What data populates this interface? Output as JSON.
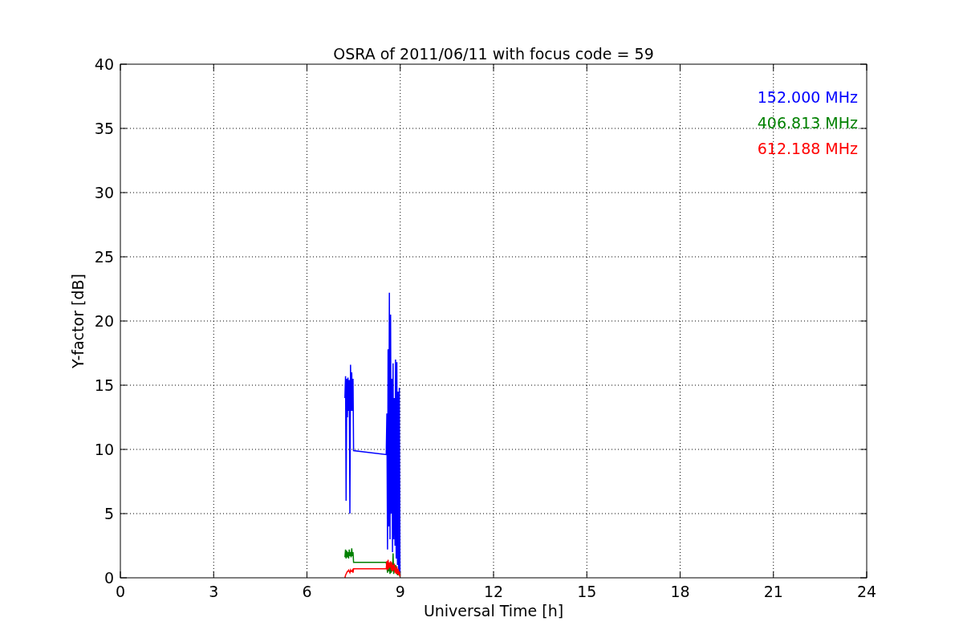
{
  "chart_data": {
    "type": "line",
    "title": "OSRA of 2011/06/11 with focus code = 59",
    "xlabel": "Universal Time [h]",
    "ylabel": "Y-factor [dB]",
    "x": [
      7.22,
      7.24,
      7.26,
      7.28,
      7.3,
      7.32,
      7.34,
      7.36,
      7.38,
      7.4,
      7.42,
      7.44,
      7.46,
      7.48,
      7.5,
      8.55,
      8.57,
      8.59,
      8.61,
      8.63,
      8.65,
      8.67,
      8.69,
      8.71,
      8.73,
      8.75,
      8.77,
      8.79,
      8.81,
      8.83,
      8.85,
      8.87,
      8.89,
      8.91,
      8.93,
      8.95,
      8.97,
      8.99
    ],
    "series": [
      {
        "name": "152.000 MHz",
        "color": "#0000ff",
        "values": [
          14,
          15.7,
          6,
          15.5,
          12.5,
          15.6,
          13,
          15.4,
          5,
          16.6,
          13,
          16,
          13,
          15.5,
          9.9,
          9.6,
          12.8,
          2.2,
          17.8,
          4,
          22.2,
          3,
          20.5,
          5,
          15.5,
          2,
          16.7,
          3,
          14,
          2.5,
          17,
          1.5,
          16.8,
          1,
          14.5,
          0.5,
          14.8,
          0.3
        ]
      },
      {
        "name": "406.813 MHz",
        "color": "#008000",
        "values": [
          1.6,
          2.2,
          1.5,
          2.1,
          1.6,
          2.0,
          1.5,
          2.2,
          1.7,
          2.0,
          1.6,
          2.3,
          1.7,
          2.0,
          1.2,
          1.2,
          0.8,
          0.4,
          1.0,
          0.5,
          0.9,
          0.3,
          1.1,
          0.4,
          0.8,
          0.5,
          1.9,
          0.3,
          0.8,
          0.5,
          1.0,
          0.4,
          0.7,
          0.2,
          0.6,
          0.3,
          0.5,
          0.1
        ]
      },
      {
        "name": "612.188 MHz",
        "color": "#ff0000",
        "values": [
          0,
          0.2,
          0.3,
          0.4,
          0.5,
          0.5,
          0.6,
          0.5,
          0.4,
          0.6,
          0.5,
          0.5,
          0.6,
          0.4,
          0.7,
          0.7,
          1.3,
          0.6,
          1.4,
          0.7,
          1.2,
          0.8,
          1.3,
          0.6,
          1.2,
          0.5,
          1.0,
          0.6,
          1.1,
          0.4,
          0.8,
          0.3,
          0.9,
          0.3,
          0.7,
          0.2,
          0.5,
          0.1
        ]
      }
    ],
    "grid": true,
    "xlim": [
      0,
      24
    ],
    "ylim": [
      0,
      40
    ],
    "xticks": [
      0,
      3,
      6,
      9,
      12,
      15,
      18,
      21,
      24
    ],
    "yticks": [
      0,
      5,
      10,
      15,
      20,
      25,
      30,
      35,
      40
    ]
  }
}
